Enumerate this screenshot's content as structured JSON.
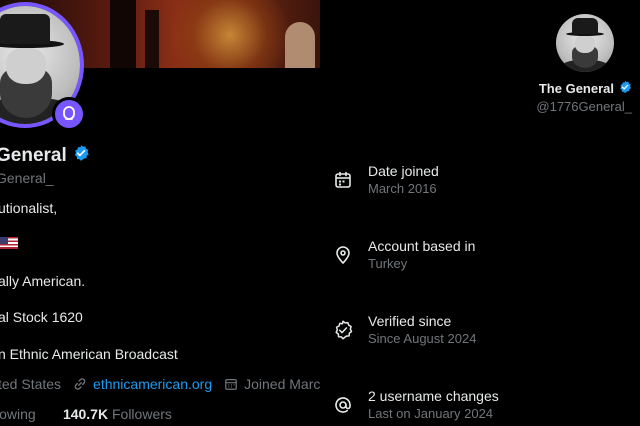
{
  "left_profile": {
    "display_name": "General",
    "handle": "General_",
    "bio_lines": [
      "utionalist,",
      "ally American.",
      "al Stock 1620",
      "n Ethnic American Broadcast"
    ],
    "location": "ted States",
    "website": "ethnicamerican.org",
    "joined": "Joined Marc",
    "following_label": "lowing",
    "followers_count": "140.7K",
    "followers_label": "Followers"
  },
  "right_about": {
    "display_name": "The General",
    "handle": "@1776General_",
    "rows": [
      {
        "title": "Date joined",
        "subtitle": "March 2016",
        "icon": "calendar-icon"
      },
      {
        "title": "Account based in",
        "subtitle": "Turkey",
        "icon": "location-pin-icon"
      },
      {
        "title": "Verified since",
        "subtitle": "Since August 2024",
        "icon": "verified-check-icon"
      },
      {
        "title": "2 username changes",
        "subtitle": "Last on January 2024",
        "icon": "at-sign-icon"
      }
    ]
  },
  "colors": {
    "accent_blue": "#1d9bf0",
    "subscription_purple": "#7856ff",
    "muted_text": "#71767b",
    "primary_text": "#e7e9ea",
    "background": "#000000"
  }
}
